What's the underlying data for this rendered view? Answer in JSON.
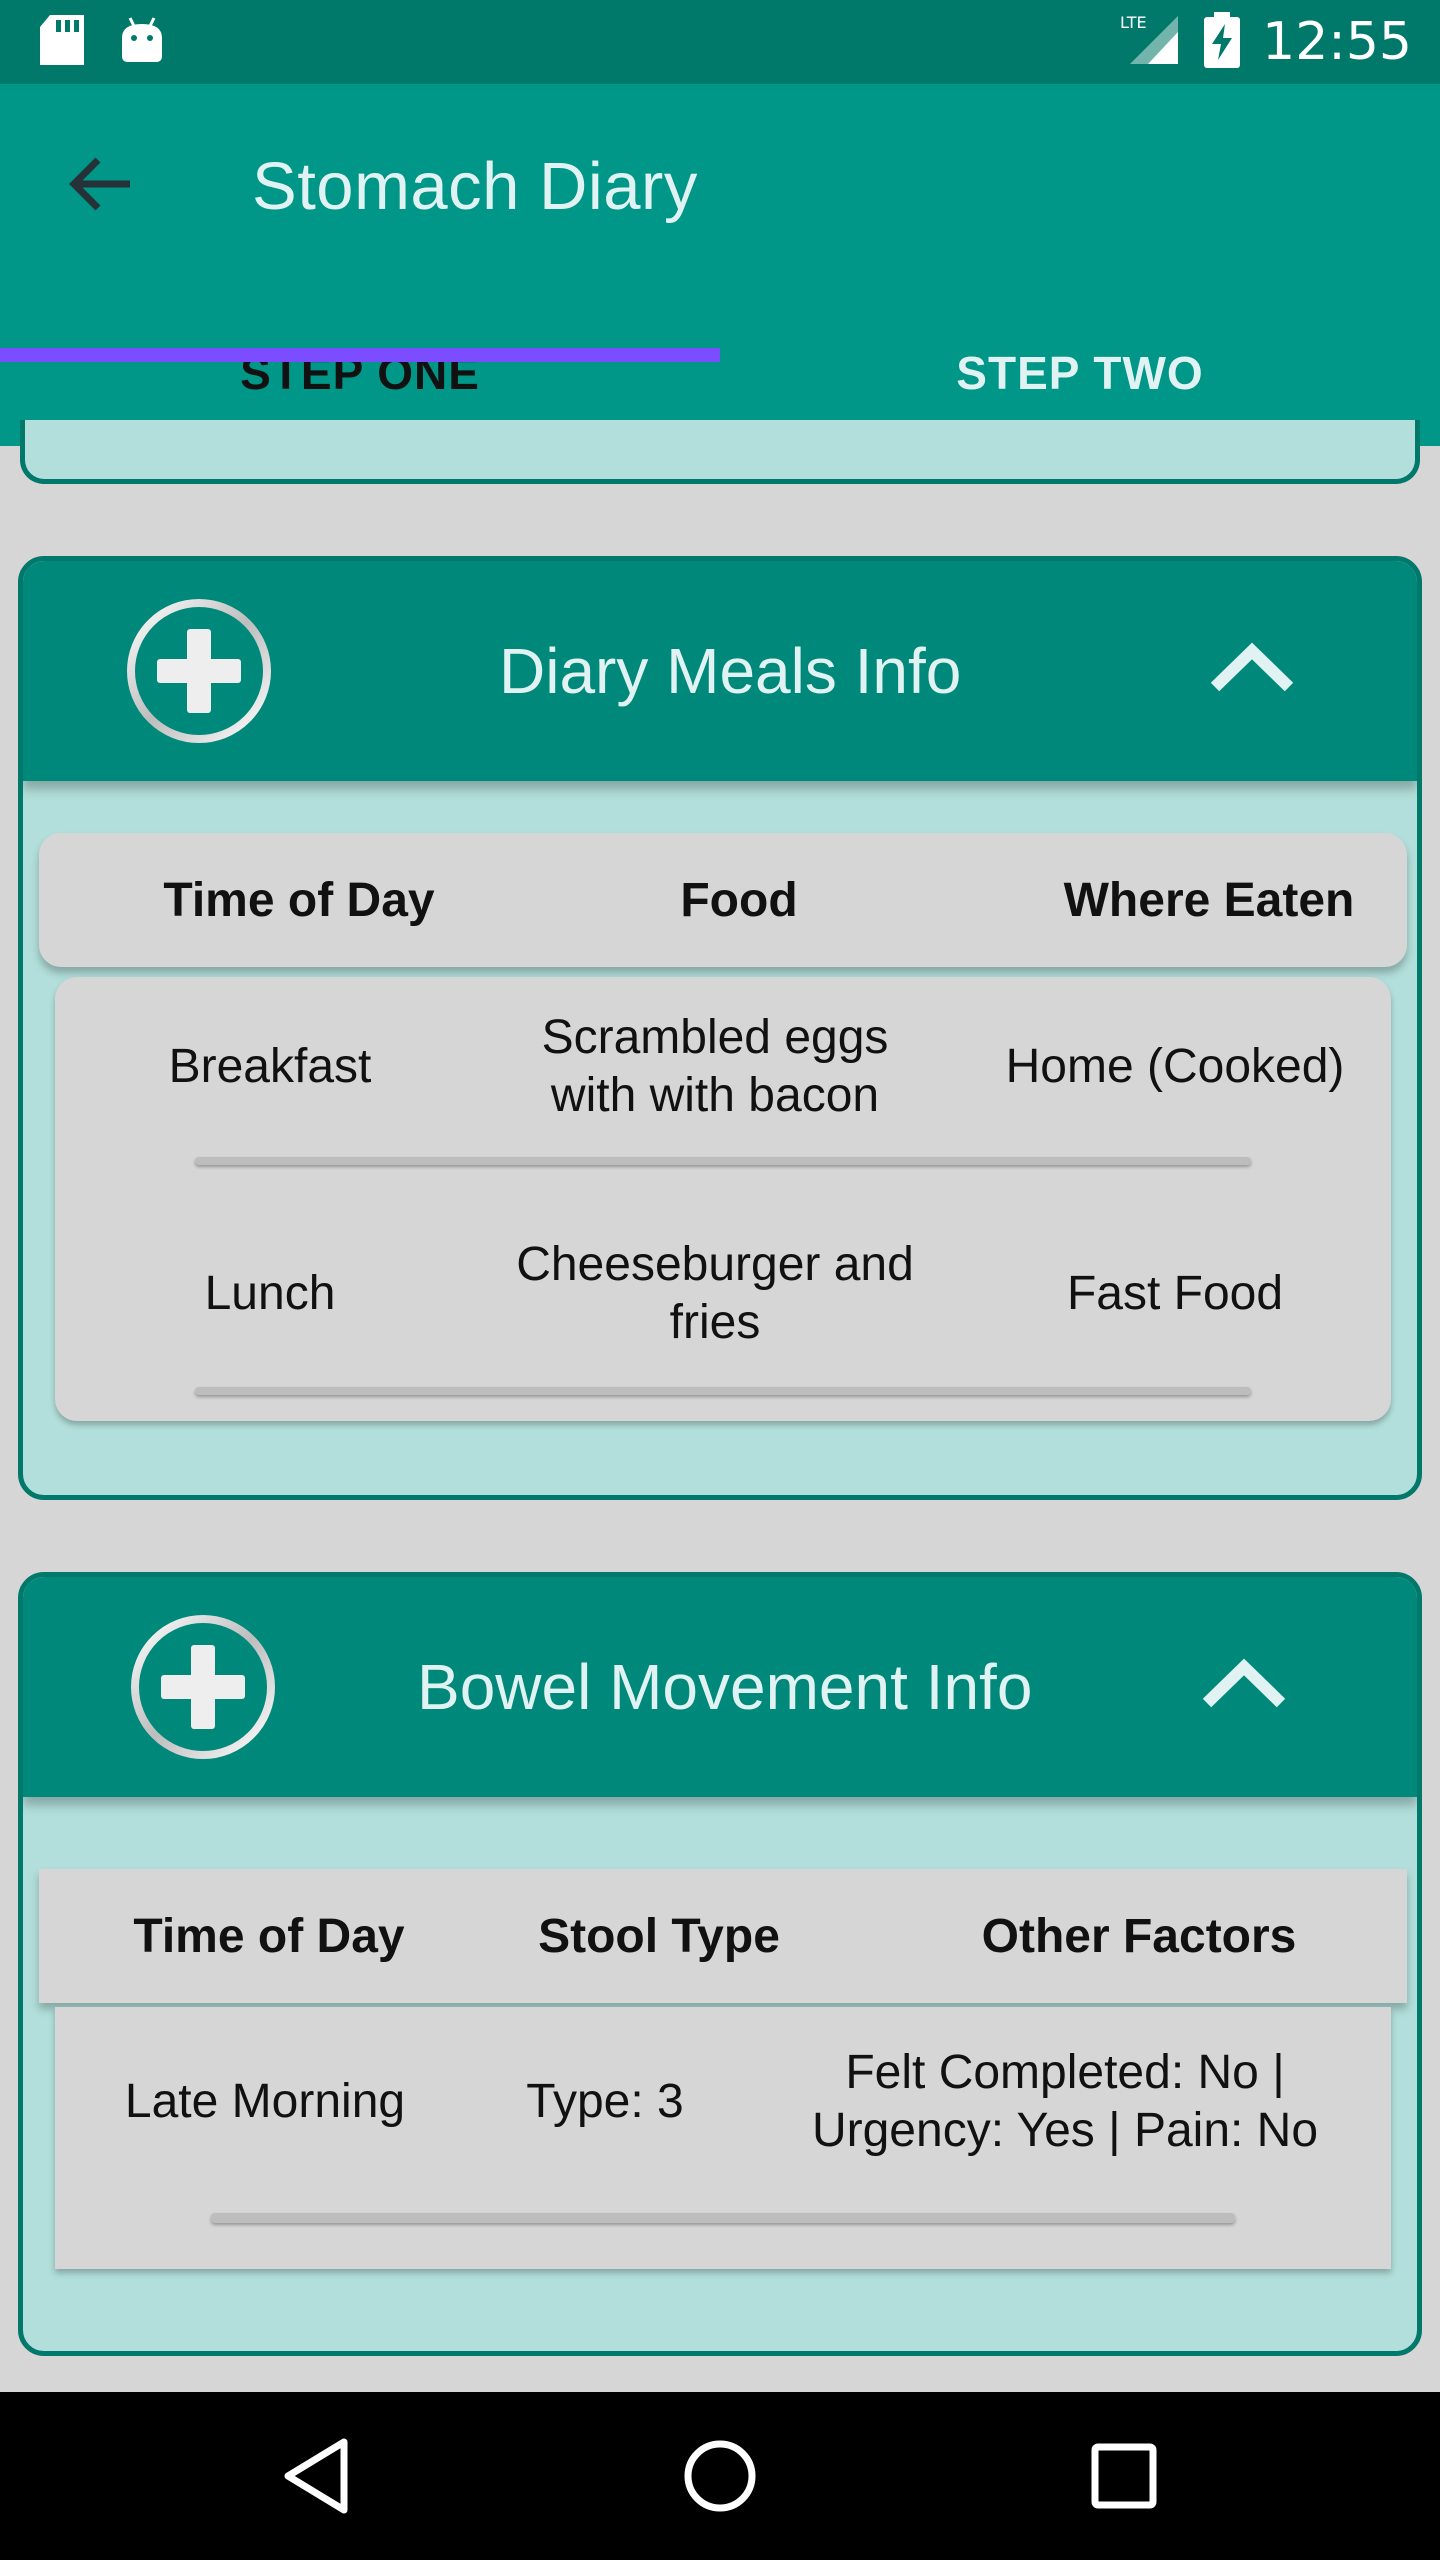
{
  "status_bar": {
    "time": "12:55",
    "network": "LTE",
    "icons": [
      "sd-card-icon",
      "android-icon",
      "lte-signal-icon",
      "battery-charging-icon"
    ]
  },
  "app_bar": {
    "title": "Stomach Diary",
    "tabs": [
      {
        "label": "STEP ONE",
        "selected": true
      },
      {
        "label": "STEP TWO",
        "selected": false
      }
    ],
    "colors": {
      "primary": "#009688",
      "primary_dark": "#00796b",
      "accent": "#7c4dff",
      "card_bg": "#b2dfdb"
    }
  },
  "meals": {
    "title": "Diary Meals Info",
    "columns": [
      "Time of Day",
      "Food",
      "Where Eaten"
    ],
    "rows": [
      {
        "time": "Breakfast",
        "food_line1": "Scrambled eggs",
        "food_line2": "with with bacon",
        "where": "Home (Cooked)"
      },
      {
        "time": "Lunch",
        "food_line1": "Cheeseburger and",
        "food_line2": "fries",
        "where": "Fast Food"
      }
    ]
  },
  "bowel": {
    "title": "Bowel Movement Info",
    "columns": [
      "Time of Day",
      "Stool Type",
      "Other Factors"
    ],
    "rows": [
      {
        "time": "Late Morning",
        "type": "Type: 3",
        "factors_line1": "Felt Completed: No  |",
        "factors_line2": "Urgency: Yes  |  Pain: No"
      }
    ]
  },
  "nav_bar": {
    "icons": [
      "back-triangle-icon",
      "home-circle-icon",
      "recents-square-icon"
    ]
  }
}
